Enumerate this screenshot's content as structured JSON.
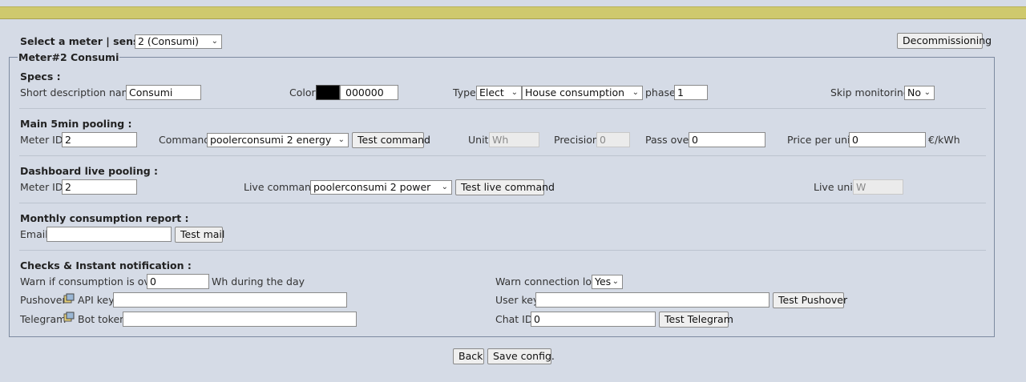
{
  "header": {
    "select_label": "Select a meter | sensor :",
    "meter_select_value": "2 (Consumi)",
    "decommission_label": "Decommissioning"
  },
  "meter": {
    "legend": "Meter#2 Consumi"
  },
  "specs": {
    "title": "Specs :",
    "short_desc_label": "Short description name",
    "short_desc_value": "Consumi",
    "color_label": "Color",
    "color_value": "000000",
    "color_hex": "#000000",
    "type_label": "Type",
    "type_value": "Elect",
    "type2_value": "House consumption",
    "phase_label": "phase",
    "phase_value": "1",
    "skip_label": "Skip monitoring",
    "skip_value": "No"
  },
  "main_pooling": {
    "title": "Main 5min pooling :",
    "meter_id_label": "Meter ID",
    "meter_id_value": "2",
    "command_label": "Command",
    "command_value": "poolerconsumi 2 energy",
    "test_command_label": "Test command",
    "unit_label": "Unit",
    "unit_value": "Wh",
    "precision_label": "Precision",
    "precision_value": "0",
    "pass_over_label": "Pass over",
    "pass_over_value": "0",
    "price_label": "Price per unit",
    "price_value": "0",
    "price_unit": "€/kWh"
  },
  "dashboard": {
    "title": "Dashboard live pooling :",
    "meter_id_label": "Meter ID",
    "meter_id_value": "2",
    "live_command_label": "Live command",
    "live_command_value": "poolerconsumi 2 power",
    "test_live_label": "Test live command",
    "live_unit_label": "Live unit",
    "live_unit_value": "W"
  },
  "report": {
    "title": "Monthly consumption report :",
    "email_label": "Email",
    "email_value": "",
    "test_mail_label": "Test mail"
  },
  "checks": {
    "title": "Checks & Instant notification :",
    "warn_label": "Warn if consumption is over",
    "warn_value": "0",
    "warn_suffix": "Wh during the day",
    "warn_conn_label": "Warn connection lost",
    "warn_conn_value": "Yes",
    "pushover_label": "Pushover",
    "api_key_label": "API key",
    "api_key_value": "",
    "user_key_label": "User key",
    "user_key_value": "",
    "test_pushover_label": "Test Pushover",
    "telegram_label": "Telegram",
    "bot_token_label": "Bot token",
    "bot_token_value": "",
    "chat_id_label": "Chat ID",
    "chat_id_value": "0",
    "test_telegram_label": "Test Telegram"
  },
  "footer": {
    "back_label": "Back",
    "save_label": "Save config."
  },
  "colors": {
    "topbar": "#cfc96d",
    "background": "#d5dbe6"
  }
}
